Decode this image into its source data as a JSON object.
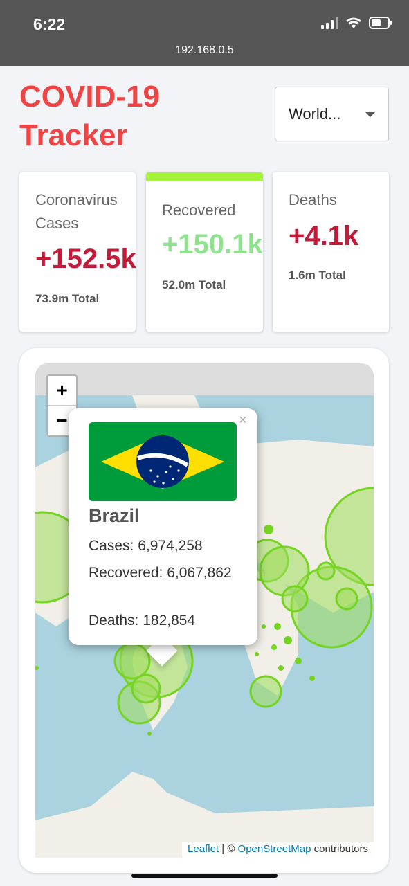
{
  "status_bar": {
    "time": "6:22",
    "url": "192.168.0.5",
    "icons": [
      "signal-icon",
      "wifi-icon",
      "battery-icon"
    ]
  },
  "header": {
    "title": "COVID-19 Tracker",
    "country_select_value": "World..."
  },
  "cards": {
    "cases": {
      "label": "Coronavirus Cases",
      "value": "+152.5k",
      "total": "73.9m Total",
      "color": "#c31a3a"
    },
    "recovered": {
      "label": "Recovered",
      "value": "+150.1k",
      "total": "52.0m Total",
      "color": "#8fe38f",
      "active": true
    },
    "deaths": {
      "label": "Deaths",
      "value": "+4.1k",
      "total": "1.6m Total",
      "color": "#c31a3a"
    }
  },
  "map": {
    "zoom_in": "+",
    "zoom_out": "−",
    "attribution": {
      "leaflet": "Leaflet",
      "separator": " | © ",
      "osm": "OpenStreetMap",
      "suffix": " contributors"
    },
    "popup": {
      "close": "×",
      "country": "Brazil",
      "cases_line": "Cases: 6,974,258",
      "recovered_line": "Recovered: 6,067,862",
      "deaths_line": "Deaths: 182,854"
    }
  },
  "colors": {
    "title": "#f04444",
    "accent": "#a6f43a",
    "circle_fill": "#9cdc5a",
    "circle_stroke": "#74d420",
    "water": "#aad3df",
    "land": "#f2efe9"
  }
}
